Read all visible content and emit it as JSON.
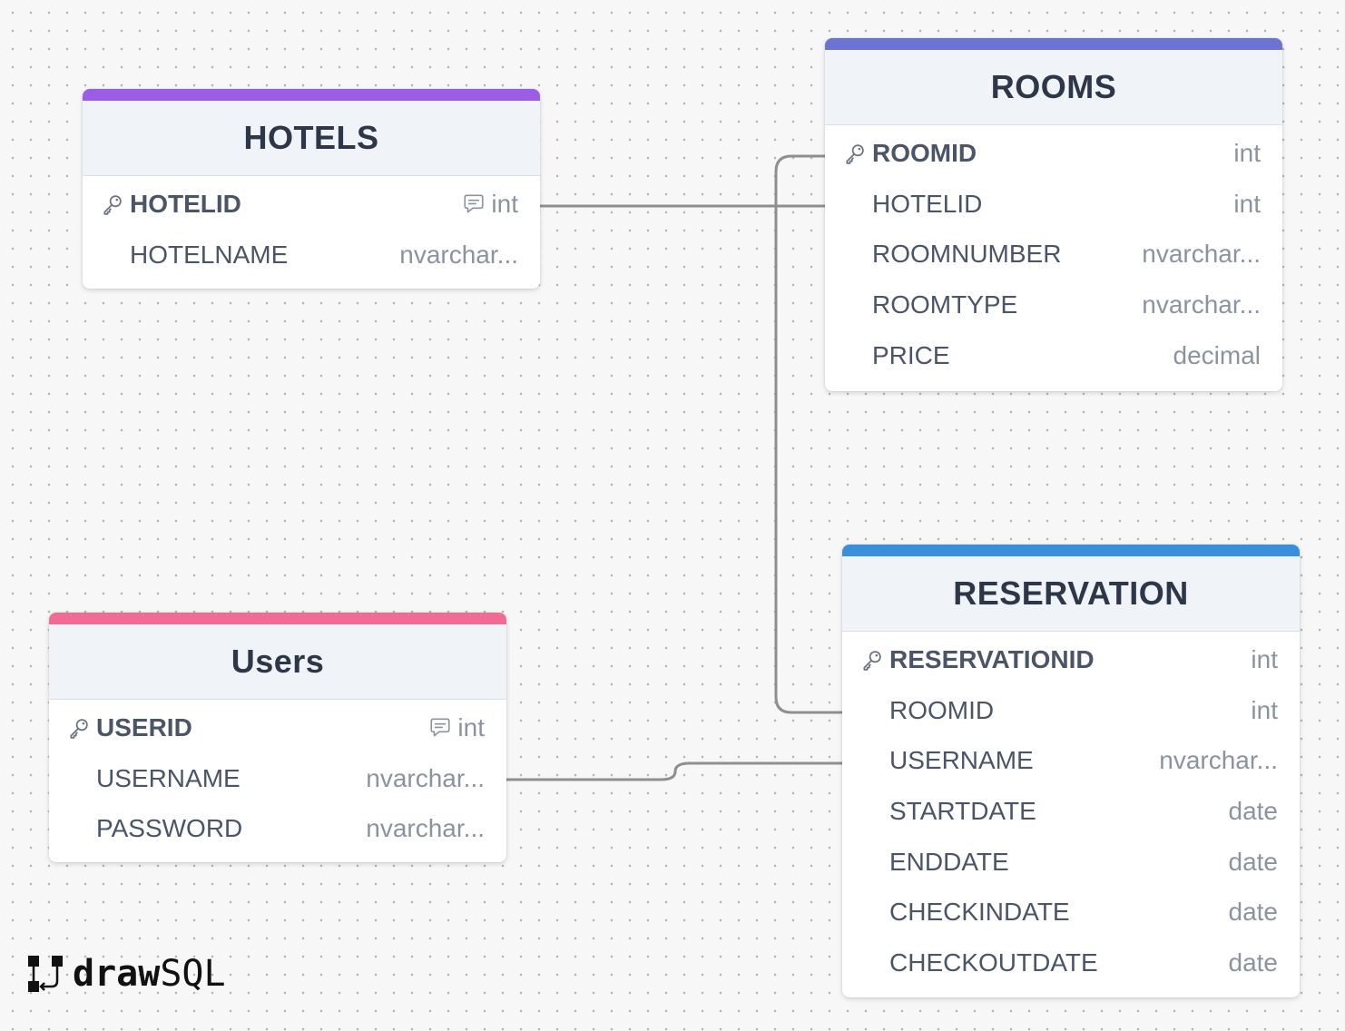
{
  "tables": {
    "hotels": {
      "title": "HOTELS",
      "accent_color": "#9b5de5",
      "columns": [
        {
          "name": "HOTELID",
          "type": "int",
          "primary_key": true,
          "comment": true
        },
        {
          "name": "HOTELNAME",
          "type": "nvarchar...",
          "primary_key": false,
          "comment": false
        }
      ]
    },
    "rooms": {
      "title": "ROOMS",
      "accent_color": "#6b74d1",
      "columns": [
        {
          "name": "ROOMID",
          "type": "int",
          "primary_key": true,
          "comment": false
        },
        {
          "name": "HOTELID",
          "type": "int",
          "primary_key": false,
          "comment": false
        },
        {
          "name": "ROOMNUMBER",
          "type": "nvarchar...",
          "primary_key": false,
          "comment": false
        },
        {
          "name": "ROOMTYPE",
          "type": "nvarchar...",
          "primary_key": false,
          "comment": false
        },
        {
          "name": "PRICE",
          "type": "decimal",
          "primary_key": false,
          "comment": false
        }
      ]
    },
    "users": {
      "title": "Users",
      "accent_color": "#f06b96",
      "columns": [
        {
          "name": "USERID",
          "type": "int",
          "primary_key": true,
          "comment": true
        },
        {
          "name": "USERNAME",
          "type": "nvarchar...",
          "primary_key": false,
          "comment": false
        },
        {
          "name": "PASSWORD",
          "type": "nvarchar...",
          "primary_key": false,
          "comment": false
        }
      ]
    },
    "reservation": {
      "title": "RESERVATION",
      "accent_color": "#3a8fdc",
      "columns": [
        {
          "name": "RESERVATIONID",
          "type": "int",
          "primary_key": true,
          "comment": false
        },
        {
          "name": "ROOMID",
          "type": "int",
          "primary_key": false,
          "comment": false
        },
        {
          "name": "USERNAME",
          "type": "nvarchar...",
          "primary_key": false,
          "comment": false
        },
        {
          "name": "STARTDATE",
          "type": "date",
          "primary_key": false,
          "comment": false
        },
        {
          "name": "ENDDATE",
          "type": "date",
          "primary_key": false,
          "comment": false
        },
        {
          "name": "CHECKINDATE",
          "type": "date",
          "primary_key": false,
          "comment": false
        },
        {
          "name": "CHECKOUTDATE",
          "type": "date",
          "primary_key": false,
          "comment": false
        }
      ]
    }
  },
  "relations": [
    {
      "from": "HOTELS.HOTELID",
      "to": "ROOMS.HOTELID"
    },
    {
      "from": "ROOMS.ROOMID",
      "to": "RESERVATION.ROOMID"
    },
    {
      "from": "Users.USERNAME",
      "to": "RESERVATION.USERNAME"
    }
  ],
  "branding": {
    "logo_bold": "draw",
    "logo_regular": "SQL"
  },
  "colors": {
    "connector": "#8f8f8f",
    "header_bg": "#f0f3f8",
    "title_text": "#2d3748",
    "column_text": "#4a5568",
    "type_text": "#8b93a1"
  }
}
